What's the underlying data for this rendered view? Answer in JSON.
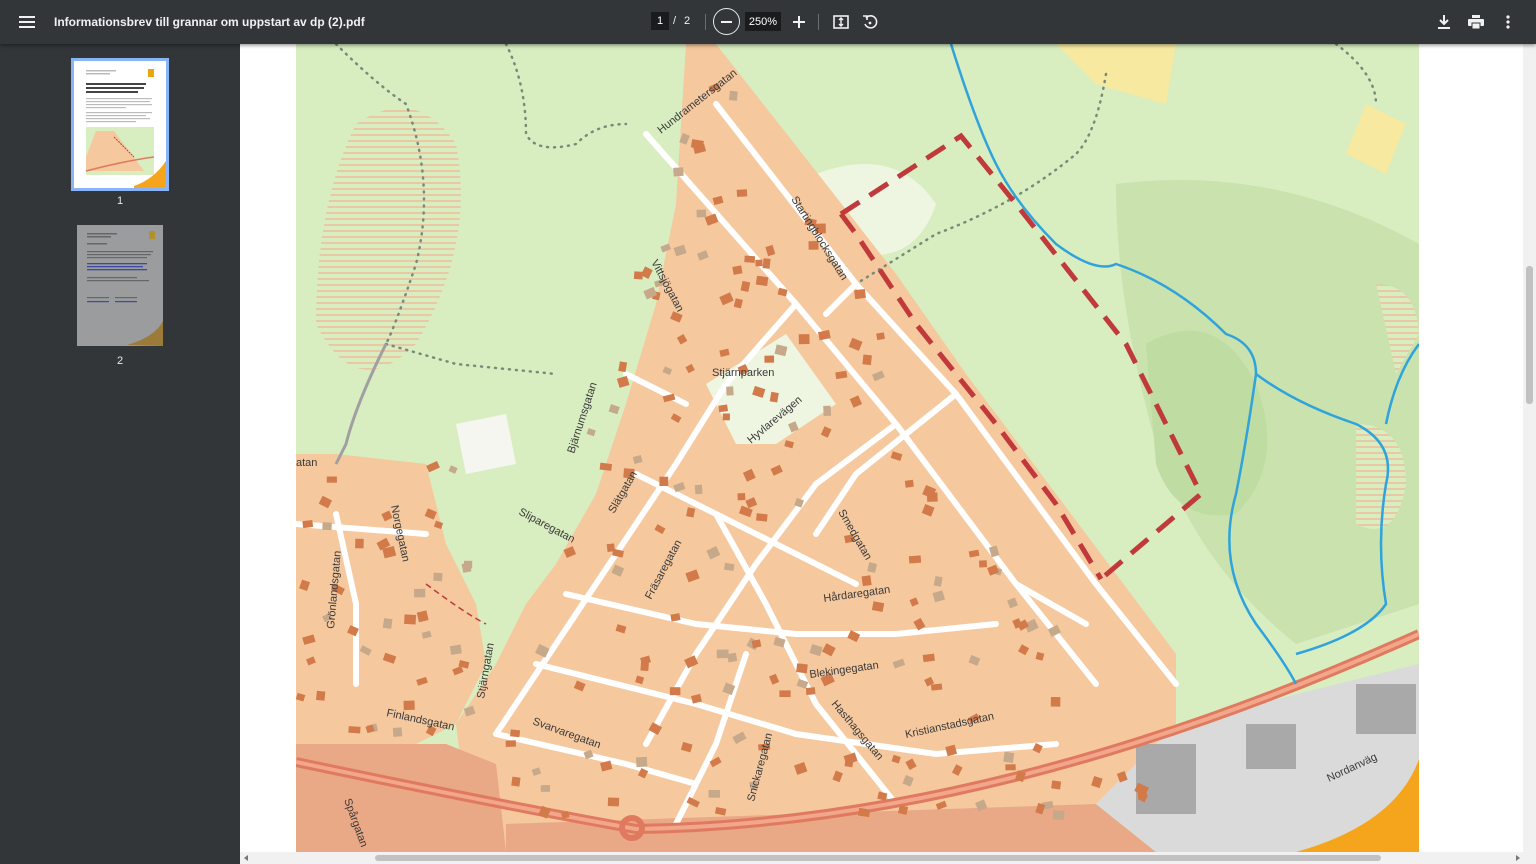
{
  "toolbar": {
    "file_title": "Informationsbrev till grannar om uppstart av dp (2).pdf",
    "current_page": "1",
    "page_separator": "/",
    "total_pages": "2",
    "zoom": "250%"
  },
  "sidebar": {
    "thumbnails": [
      {
        "label": "1"
      },
      {
        "label": "2"
      }
    ]
  },
  "map": {
    "park_label": "Stjärnparken",
    "streets": [
      "Hundrametersgatan",
      "Startingblocksgatan",
      "Vittsjögatan",
      "Hyvlarevägen",
      "Bjärnumsgatan",
      "Slätgatan",
      "Sliparegatan",
      "Norgegatan",
      "Grönlandsgatan",
      "Fräsaregatan",
      "Smedgatan",
      "Hårdaregatan",
      "Blekingegatan",
      "Hasthagsgatan",
      "Kristianstadsgatan",
      "Stjärngatan",
      "Finlandsgatan",
      "Svarvaregatan",
      "Snickaregatan",
      "Spårgatan",
      "Nordanväg",
      "atan"
    ]
  },
  "colors": {
    "toolbar_bg": "#323639",
    "residential": "#f5c89e",
    "green_area": "#d8edc0",
    "boundary": "#c0393b",
    "water": "#2ea3dc",
    "road": "#e07a5f",
    "accent": "#8ab4f8"
  },
  "icons": [
    "menu-icon",
    "zoom-out-icon",
    "zoom-in-icon",
    "fit-page-icon",
    "rotate-icon",
    "download-icon",
    "print-icon",
    "more-vert-icon"
  ]
}
